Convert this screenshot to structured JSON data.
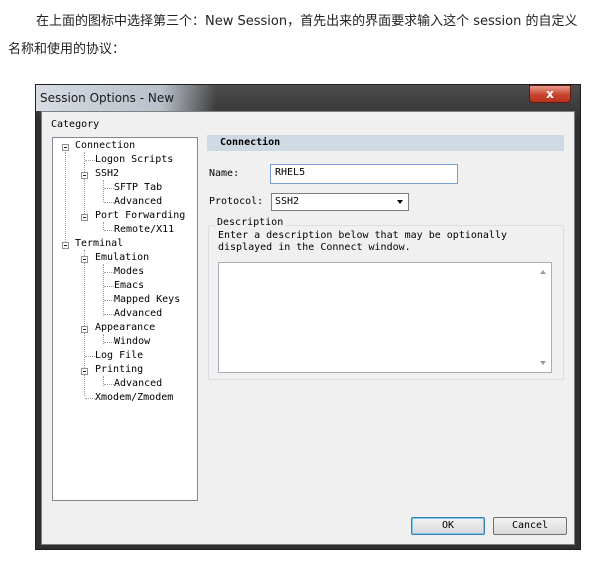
{
  "intro": {
    "line1": "在上面的图标中选择第三个：New Session，首先出来的界面要求输入这个 session 的自定义名称和使用的协议："
  },
  "window": {
    "title": "Session Options - New",
    "close_glyph": "x"
  },
  "category": {
    "label": "Category",
    "tree": [
      {
        "id": "connection",
        "label": "Connection"
      },
      {
        "id": "logon-scripts",
        "label": "Logon Scripts"
      },
      {
        "id": "ssh2",
        "label": "SSH2"
      },
      {
        "id": "sftp-tab",
        "label": "SFTP Tab"
      },
      {
        "id": "ssh2-advanced",
        "label": "Advanced"
      },
      {
        "id": "port-forwarding",
        "label": "Port Forwarding"
      },
      {
        "id": "remote-x11",
        "label": "Remote/X11"
      },
      {
        "id": "terminal",
        "label": "Terminal"
      },
      {
        "id": "emulation",
        "label": "Emulation"
      },
      {
        "id": "modes",
        "label": "Modes"
      },
      {
        "id": "emacs",
        "label": "Emacs"
      },
      {
        "id": "mapped-keys",
        "label": "Mapped Keys"
      },
      {
        "id": "emulation-advanced",
        "label": "Advanced"
      },
      {
        "id": "appearance",
        "label": "Appearance"
      },
      {
        "id": "window",
        "label": "Window"
      },
      {
        "id": "log-file",
        "label": "Log File"
      },
      {
        "id": "printing",
        "label": "Printing"
      },
      {
        "id": "printing-advanced",
        "label": "Advanced"
      },
      {
        "id": "xmodem-zmodem",
        "label": "Xmodem/Zmodem"
      }
    ]
  },
  "panel": {
    "header": "Connection",
    "name_label": "Name:",
    "name_value": "RHEL5",
    "protocol_label": "Protocol:",
    "protocol_value": "SSH2",
    "description_title": "Description",
    "description_hint_line1": "Enter a description below that may be optionally",
    "description_hint_line2": "displayed in the Connect window.",
    "description_value": ""
  },
  "buttons": {
    "ok": "OK",
    "cancel": "Cancel"
  }
}
